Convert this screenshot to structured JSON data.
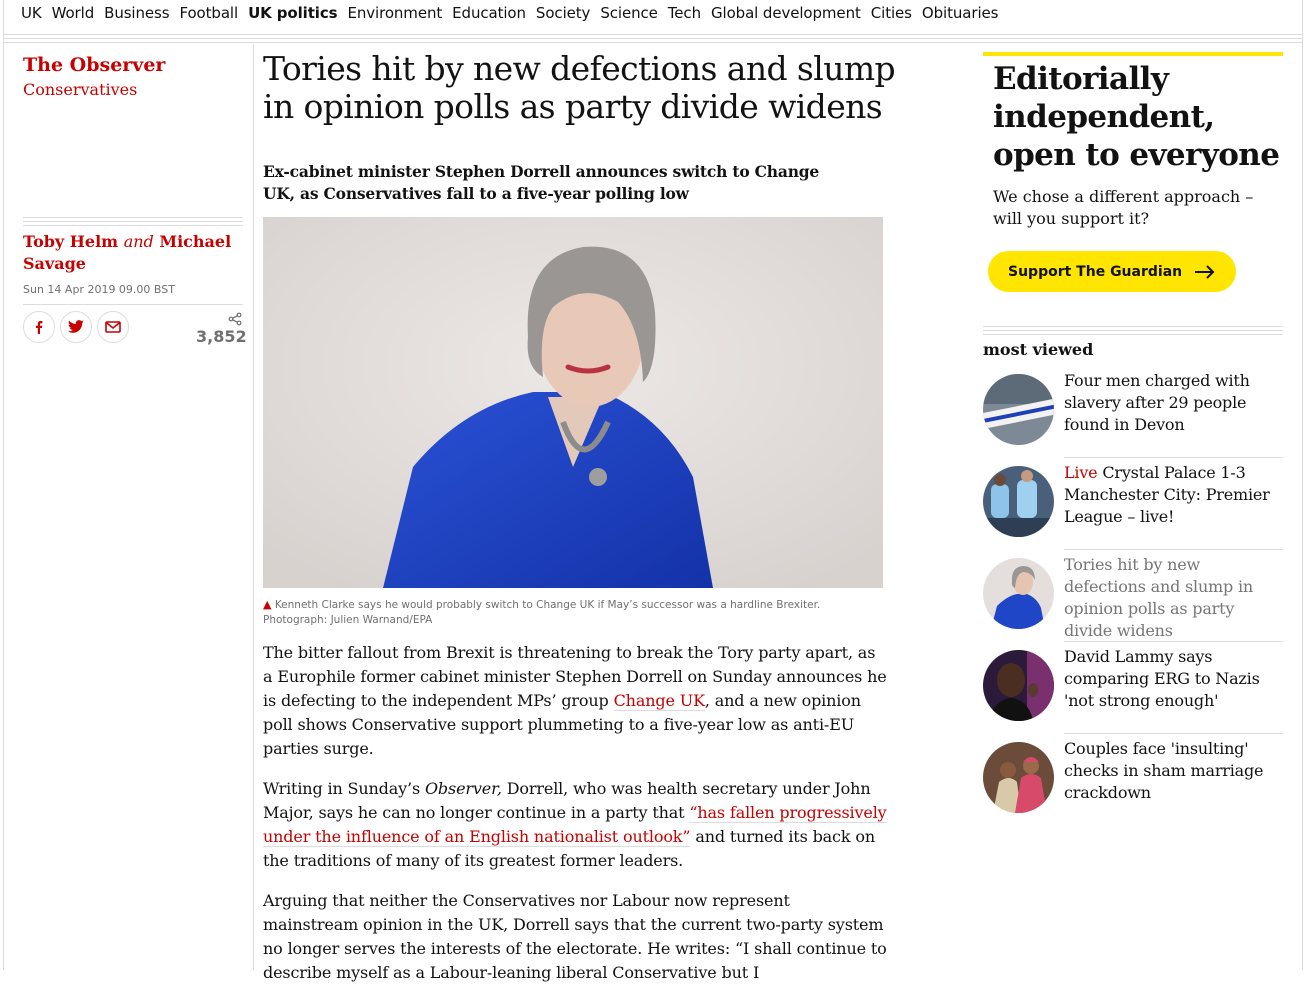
{
  "nav": {
    "items": [
      "UK",
      "World",
      "Business",
      "Football",
      "UK politics",
      "Environment",
      "Education",
      "Society",
      "Science",
      "Tech",
      "Global development",
      "Cities",
      "Obituaries"
    ],
    "active": "UK politics"
  },
  "sidebar": {
    "brand": "The Observer",
    "section": "Conservatives",
    "author1": "Toby Helm",
    "and": "and",
    "author2": "Michael Savage",
    "date": "Sun 14 Apr 2019 09.00 BST",
    "share_count": "3,852"
  },
  "article": {
    "headline": "Tories hit by new defections and slump in opinion polls as party divide widens",
    "standfirst": "Ex-cabinet minister Stephen Dorrell announces switch to Change UK, as Conservatives fall to a five-year polling low",
    "caption": "Kenneth Clarke says he would probably switch to Change UK if May’s successor was a hardline Brexiter. Photograph: Julien Warnand/EPA",
    "p1_a": "The bitter fallout from Brexit is threatening to break the Tory party apart, as a Europhile former cabinet minister Stephen Dorrell on Sunday announces he is defecting to the independent MPs’ group ",
    "p1_link": "Change UK",
    "p1_b": ", and a new opinion poll shows Conservative support plummeting to a five-year low as anti-EU parties surge.",
    "p2_a": "Writing in Sunday’s ",
    "p2_em": "Observer,",
    "p2_b": " Dorrell, who was health secretary under John Major, says he can no longer continue in a party that ",
    "p2_link": "“has fallen progressively under the influence of an English nationalist outlook”",
    "p2_c": " and turned its back on the traditions of many of its greatest former leaders.",
    "p3": "Arguing that neither the Conservatives nor Labour now represent mainstream opinion in the UK, Dorrell says that the current two-party system no longer serves the interests of the electorate. He writes: “I shall continue to describe myself as a Labour-leaning liberal Conservative but I"
  },
  "support": {
    "title": "Editorially independent, open to everyone",
    "subtitle": "We chose a different approach – will you support it?",
    "button_label": "Support The Guardian"
  },
  "most_viewed": {
    "title": "most viewed",
    "items": [
      {
        "text": "Four men charged with slavery after 29 people found in Devon"
      },
      {
        "kicker": "Live",
        "text": "Crystal Palace 1-3 Manchester City: Premier League – live!"
      },
      {
        "text": "Tories hit by new defections and slump in opinion polls as party divide widens"
      },
      {
        "text": "David Lammy says comparing ERG to Nazis 'not strong enough'"
      },
      {
        "text": "Couples face 'insulting' checks in sham marriage crackdown"
      }
    ]
  },
  "colors": {
    "accent": "#c70000",
    "support_yellow": "#ffe500",
    "rule": "#dcdcdc"
  }
}
